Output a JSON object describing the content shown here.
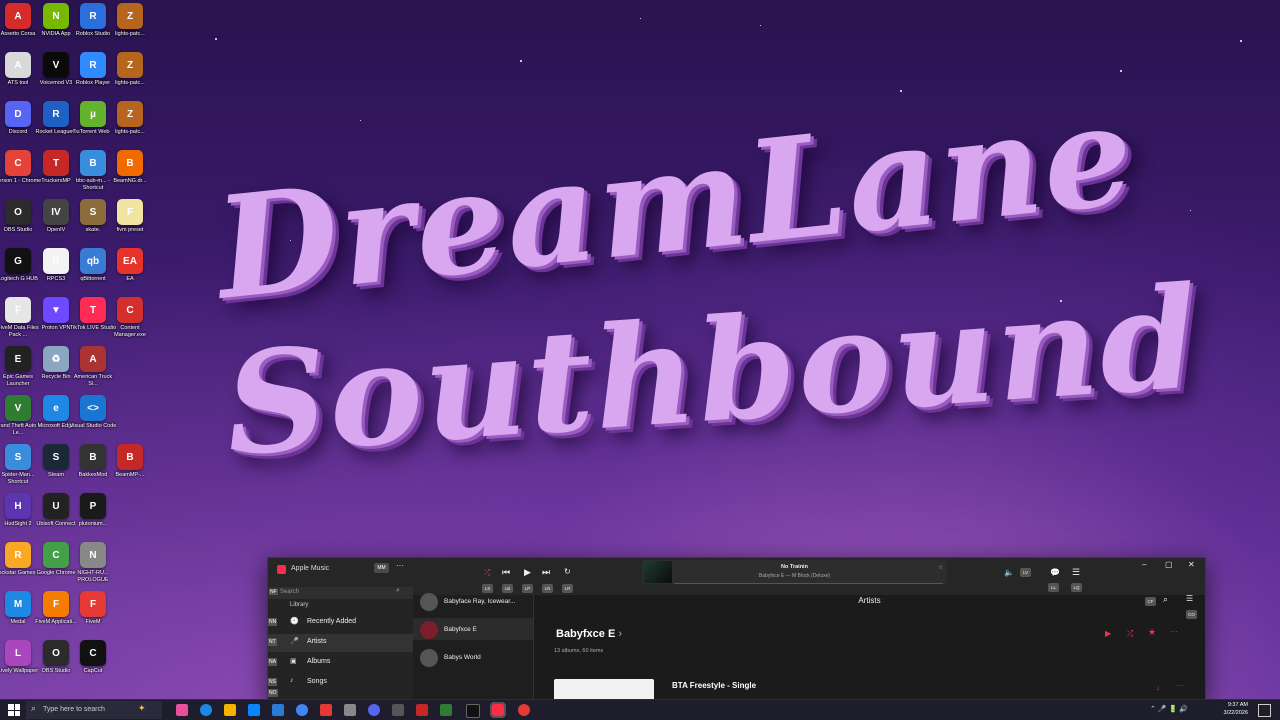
{
  "desktop": {
    "icons": [
      {
        "label": "Assetto Corsa",
        "color": "#d52b2b",
        "glyph": "A"
      },
      {
        "label": "NVIDIA App",
        "color": "#76b900",
        "glyph": "N"
      },
      {
        "label": "Roblox Studio",
        "color": "#2a6fdc",
        "glyph": "R"
      },
      {
        "label": "lights-patc...",
        "color": "#b5651d",
        "glyph": "Z"
      },
      {
        "label": "ATS tool",
        "color": "#d9d9d9",
        "glyph": "A"
      },
      {
        "label": "Voicemod V3",
        "color": "#0a0a0a",
        "glyph": "V"
      },
      {
        "label": "Roblox Player",
        "color": "#2f8bff",
        "glyph": "R"
      },
      {
        "label": "lights-patc...",
        "color": "#b5651d",
        "glyph": "Z"
      },
      {
        "label": "Discord",
        "color": "#5865f2",
        "glyph": "D"
      },
      {
        "label": "Rocket League®",
        "color": "#1f60c5",
        "glyph": "R"
      },
      {
        "label": "uTorrent Web",
        "color": "#63b32e",
        "glyph": "µ"
      },
      {
        "label": "lights-patc...",
        "color": "#b5651d",
        "glyph": "Z"
      },
      {
        "label": "Person 1 - Chrome",
        "color": "#e5423a",
        "glyph": "C"
      },
      {
        "label": "TruckersMP",
        "color": "#c62828",
        "glyph": "T"
      },
      {
        "label": "bbc-sub-m... - Shortcut",
        "color": "#3a8ddc",
        "glyph": "B"
      },
      {
        "label": "BeamNG.dr...",
        "color": "#f06a00",
        "glyph": "B"
      },
      {
        "label": "OBS Studio",
        "color": "#2b2b2b",
        "glyph": "O"
      },
      {
        "label": "OpenIV",
        "color": "#444444",
        "glyph": "IV"
      },
      {
        "label": "skate.",
        "color": "#8a6d3b",
        "glyph": "S"
      },
      {
        "label": "fivm preset",
        "color": "#f1e3a0",
        "glyph": "F"
      },
      {
        "label": "Logitech G HUB",
        "color": "#111111",
        "glyph": "G"
      },
      {
        "label": "RPCS3",
        "color": "#f3f3f3",
        "glyph": "R"
      },
      {
        "label": "qBittorrent",
        "color": "#3a7bd5",
        "glyph": "qb"
      },
      {
        "label": "EA",
        "color": "#e8322c",
        "glyph": "EA"
      },
      {
        "label": "FiveM Data Files Pack ...",
        "color": "#e6e6e6",
        "glyph": "F"
      },
      {
        "label": "Proton VPN",
        "color": "#6d4aff",
        "glyph": "▼"
      },
      {
        "label": "TikTok LIVE Studio",
        "color": "#ff2d55",
        "glyph": "T"
      },
      {
        "label": "Content Manager.exe",
        "color": "#d32f2f",
        "glyph": "C"
      },
      {
        "label": "Epic Games Launcher",
        "color": "#222222",
        "glyph": "E"
      },
      {
        "label": "Recycle Bin",
        "color": "#8aa6c1",
        "glyph": "♻"
      },
      {
        "label": "American Truck Si...",
        "color": "#a33",
        "glyph": "A"
      },
      {
        "label": "",
        "color": "transparent",
        "glyph": ""
      },
      {
        "label": "Grand Theft Auto V Le...",
        "color": "#2e7d32",
        "glyph": "V"
      },
      {
        "label": "Microsoft Edge",
        "color": "#1e88e5",
        "glyph": "e"
      },
      {
        "label": "Visual Studio Code",
        "color": "#1976d2",
        "glyph": "<>"
      },
      {
        "label": "",
        "color": "transparent",
        "glyph": ""
      },
      {
        "label": "Spider-Man... Shortcut",
        "color": "#3a8ddc",
        "glyph": "S"
      },
      {
        "label": "Steam",
        "color": "#1b2838",
        "glyph": "S"
      },
      {
        "label": "BakkesMod",
        "color": "#333333",
        "glyph": "B"
      },
      {
        "label": "BeamMP-...",
        "color": "#c62828",
        "glyph": "B"
      },
      {
        "label": "HudSight 2",
        "color": "#5e35b1",
        "glyph": "H"
      },
      {
        "label": "Ubisoft Connect",
        "color": "#222222",
        "glyph": "U"
      },
      {
        "label": "plutonium...",
        "color": "#1a1a1a",
        "glyph": "P"
      },
      {
        "label": "",
        "color": "transparent",
        "glyph": ""
      },
      {
        "label": "Rockstar Games ...",
        "color": "#f9a825",
        "glyph": "R"
      },
      {
        "label": "Google Chrome",
        "color": "#43a047",
        "glyph": "C"
      },
      {
        "label": "NIGHT-RU... PROLOGUE",
        "color": "#888",
        "glyph": "N"
      },
      {
        "label": "",
        "color": "transparent",
        "glyph": ""
      },
      {
        "label": "Medal",
        "color": "#1e88e5",
        "glyph": "M"
      },
      {
        "label": "FiveM Applicati...",
        "color": "#f57c00",
        "glyph": "F"
      },
      {
        "label": "FiveM",
        "color": "#e53935",
        "glyph": "F"
      },
      {
        "label": "",
        "color": "transparent",
        "glyph": ""
      },
      {
        "label": "Lively Wallpaper",
        "color": "#ab47bc",
        "glyph": "L"
      },
      {
        "label": "OBS Studio",
        "color": "#2b2b2b",
        "glyph": "O"
      },
      {
        "label": "CapCut",
        "color": "#111111",
        "glyph": "C"
      }
    ]
  },
  "title": {
    "line1": "DreamLane",
    "line2": "Southbound"
  },
  "apple_music": {
    "app_title": "Apple Music",
    "user_badge": "MM",
    "search_badge": "NF",
    "search_placeholder": "Search",
    "library_label": "Library",
    "sidebar": [
      {
        "badge": "NN",
        "label": "Recently Added"
      },
      {
        "badge": "NT",
        "label": "Artists"
      },
      {
        "badge": "NA",
        "label": "Albums"
      },
      {
        "badge": "NS",
        "label": "Songs"
      }
    ],
    "sidebar_extra_badge": "NO",
    "now_playing": {
      "title": "No Trainin",
      "subtitle": "Babyfxce E — M Block (Deluxe)"
    },
    "chips": [
      "LS",
      "LB",
      "LP",
      "LN",
      "LR"
    ],
    "right_chips": [
      "LV",
      "LL",
      "LQ"
    ],
    "artists_header": "Artists",
    "header_chips": [
      "CF",
      "CO"
    ],
    "artists_list": [
      {
        "name": "Babyface Ray, Icewear..."
      },
      {
        "name": "Babyfxce E"
      },
      {
        "name": "Babys World"
      }
    ],
    "artist_name": "Babyfxce E",
    "artist_meta": "13 albums, 60 items",
    "album_title": "BTA Freestyle - Single"
  },
  "taskbar": {
    "search_placeholder": "Type here to search",
    "time": "9:37 AM",
    "date": "3/22/2026"
  }
}
